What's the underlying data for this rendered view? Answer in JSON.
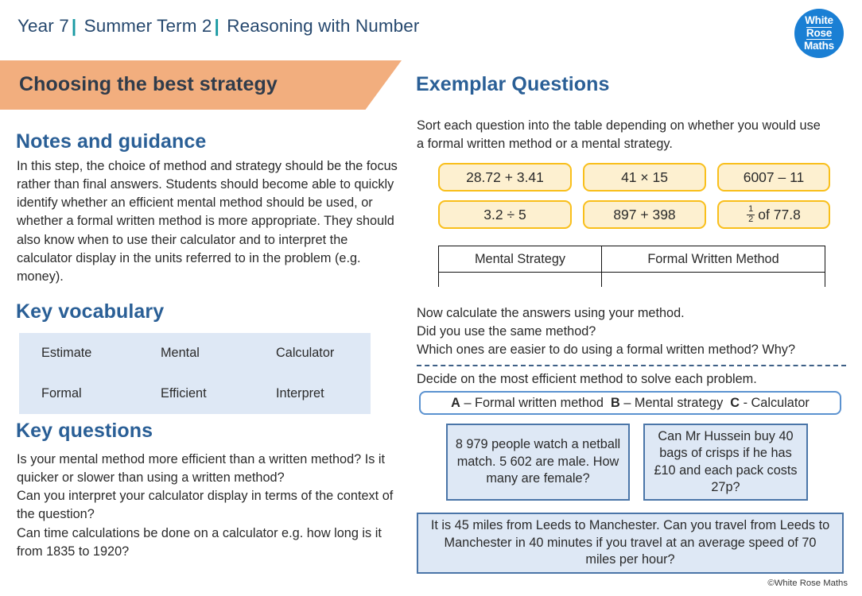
{
  "header": {
    "year": "Year 7",
    "term": "Summer Term 2",
    "unit": "Reasoning with Number",
    "separator": "|",
    "logo": {
      "line1": "White",
      "line2": "Rose",
      "line3": "Maths"
    },
    "accent_separator_color": "#1a9aa3",
    "title_color": "#26486e"
  },
  "banner": {
    "title": "Choosing the best strategy",
    "color": "#f2ae7e"
  },
  "left": {
    "notes": {
      "heading": "Notes and guidance",
      "body": "In this step, the choice of method and strategy should be the focus rather than final answers. Students should become able to quickly identify whether an efficient mental method should be used, or whether a formal written method is more appropriate. They should also know when to use their calculator and to interpret the calculator display in the units referred to in the problem (e.g. money)."
    },
    "vocabulary": {
      "heading": "Key vocabulary",
      "background_color": "#dee8f5",
      "words": [
        "Estimate",
        "Mental",
        "Calculator",
        "Formal",
        "Efficient",
        "Interpret"
      ]
    },
    "questions": {
      "heading": "Key questions",
      "body": "Is your mental method more efficient than a written method? Is it quicker or slower than using a written method?\nCan you interpret your calculator display in terms of the context of the question?\nCan time calculations be done on a calculator e.g. how long is it from 1835 to 1920?"
    }
  },
  "right": {
    "heading": "Exemplar Questions",
    "sort_intro": "Sort each question into the table depending on whether you would use a formal written method or a mental strategy.",
    "expressions": [
      {
        "text": "28.72 + 3.41",
        "fraction": false
      },
      {
        "text": "41 × 15",
        "fraction": false
      },
      {
        "text": "6007 – 11",
        "fraction": false
      },
      {
        "text": "3.2 ÷ 5",
        "fraction": false
      },
      {
        "text": "897 + 398",
        "fraction": false
      },
      {
        "text": "of 77.8",
        "fraction": true,
        "numerator": "1",
        "denominator": "2"
      }
    ],
    "expression_colors": {
      "fill": "#fdf0d0",
      "border": "#f9bf1b"
    },
    "sort_table": {
      "columns": [
        "Mental Strategy",
        "Formal Written Method"
      ],
      "rows": [
        [
          "",
          ""
        ]
      ]
    },
    "followup": [
      "Now calculate the answers using your method.",
      "Did you use the same method?",
      "Which ones are easier to do using a formal written method?  Why?"
    ],
    "decide_line": "Decide on the most efficient method to solve each problem.",
    "method_legend": {
      "a_letter": "A",
      "a_label": "– Formal written method",
      "b_letter": "B",
      "b_label": "– Mental strategy",
      "c_letter": "C",
      "c_label": "- Calculator",
      "border_color": "#5b92d0"
    },
    "problems": [
      "8 979 people watch a netball match. 5 602 are male. How many are female?",
      "Can Mr Hussein buy 40 bags of crisps if he has £10 and each pack costs 27p?",
      "It is 45 miles from Leeds to Manchester. Can you travel from Leeds to Manchester in 40 minutes if you travel at an average speed of 70 miles per hour?"
    ],
    "problem_colors": {
      "fill": "#dee8f5",
      "border": "#4a75a8"
    }
  },
  "footer": {
    "copyright": "©White Rose Maths"
  }
}
